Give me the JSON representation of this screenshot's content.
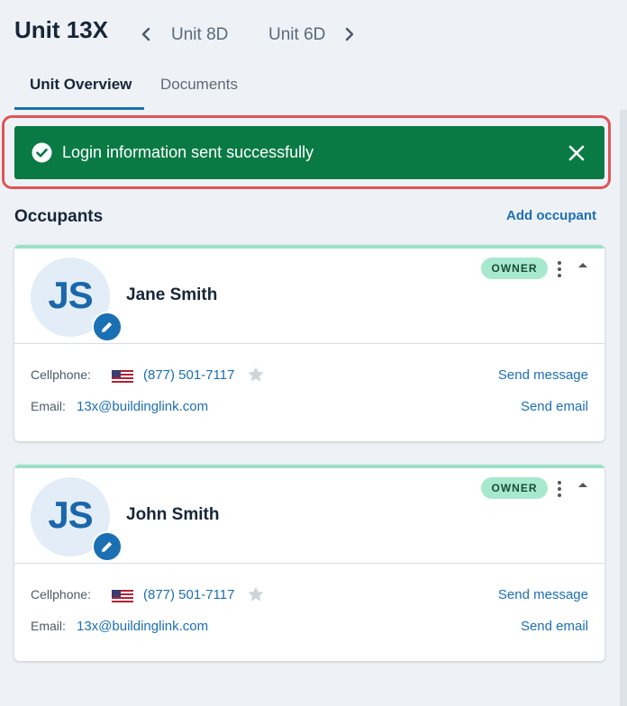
{
  "header": {
    "unit_title": "Unit 13X",
    "prev_unit": "Unit 8D",
    "next_unit": "Unit 6D"
  },
  "tabs": [
    {
      "label": "Unit Overview",
      "active": true
    },
    {
      "label": "Documents",
      "active": false
    }
  ],
  "toast": {
    "message": "Login information sent successfully",
    "icon": "check-circle-icon",
    "color": "#0a7a45"
  },
  "occupants": {
    "title": "Occupants",
    "add_label": "Add occupant",
    "list": [
      {
        "initials": "JS",
        "name": "Jane Smith",
        "role": "OWNER",
        "cellphone_label": "Cellphone:",
        "phone": "(877) 501-7117",
        "email_label": "Email:",
        "email": "13x@buildinglink.com",
        "send_message": "Send message",
        "send_email": "Send email"
      },
      {
        "initials": "JS",
        "name": "John Smith",
        "role": "OWNER",
        "cellphone_label": "Cellphone:",
        "phone": "(877) 501-7117",
        "email_label": "Email:",
        "email": "13x@buildinglink.com",
        "send_message": "Send message",
        "send_email": "Send email"
      }
    ]
  },
  "colors": {
    "accent": "#1b6fb3",
    "owner_badge": "#a7e9cf",
    "card_accent": "#9ce0c8"
  }
}
